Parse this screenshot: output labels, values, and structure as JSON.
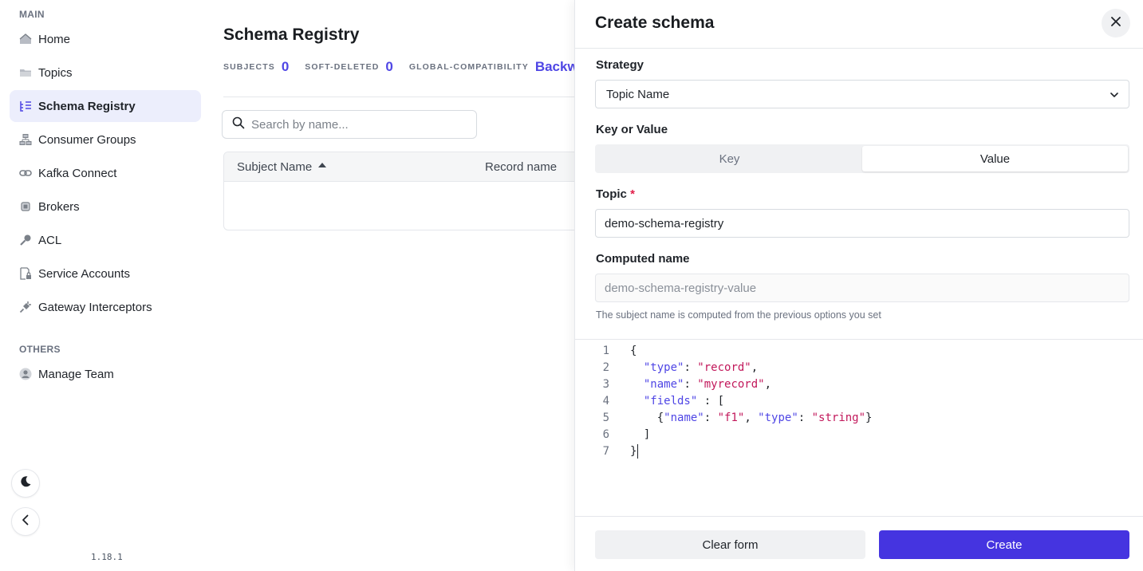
{
  "sidebar": {
    "main_label": "MAIN",
    "others_label": "OTHERS",
    "items": [
      {
        "label": "Home",
        "icon": "home-icon"
      },
      {
        "label": "Topics",
        "icon": "folder-icon"
      },
      {
        "label": "Schema Registry",
        "icon": "schema-list-icon"
      },
      {
        "label": "Consumer Groups",
        "icon": "hierarchy-icon"
      },
      {
        "label": "Kafka Connect",
        "icon": "link-icon"
      },
      {
        "label": "Brokers",
        "icon": "chip-icon"
      },
      {
        "label": "ACL",
        "icon": "key-icon"
      },
      {
        "label": "Service Accounts",
        "icon": "document-lock-icon"
      },
      {
        "label": "Gateway Interceptors",
        "icon": "plug-icon"
      }
    ],
    "others": [
      {
        "label": "Manage Team",
        "icon": "user-avatar-icon"
      }
    ],
    "version": "1.18.1"
  },
  "main": {
    "title": "Schema Registry",
    "stats": {
      "subjects_label": "SUBJECTS",
      "subjects_value": "0",
      "soft_deleted_label": "SOFT-DELETED",
      "soft_deleted_value": "0",
      "compat_label": "GLOBAL-COMPATIBILITY",
      "compat_value": "Backward"
    },
    "search_placeholder": "Search by name...",
    "table": {
      "columns": [
        "Subject Name",
        "Record name"
      ]
    }
  },
  "drawer": {
    "title": "Create schema",
    "strategy_label": "Strategy",
    "strategy_value": "Topic Name",
    "key_or_value_label": "Key or Value",
    "key_option": "Key",
    "value_option": "Value",
    "selected_option": "Value",
    "topic_label": "Topic",
    "required_mark": "*",
    "topic_value": "demo-schema-registry",
    "computed_label": "Computed name",
    "computed_value": "demo-schema-registry-value",
    "help_text": "The subject name is computed from the previous options you set",
    "code_lines": [
      "{",
      "  \"type\": \"record\",",
      "  \"name\": \"myrecord\",",
      "  \"fields\" : [",
      "    {\"name\": \"f1\", \"type\": \"string\"}",
      "  ]",
      "}"
    ],
    "clear_label": "Clear form",
    "create_label": "Create"
  },
  "colors": {
    "accent": "#4f46e5",
    "primary_button": "#4534e0",
    "active_nav_bg": "#eceefc",
    "json_key": "#4f46e5",
    "json_string": "#c2185b"
  }
}
